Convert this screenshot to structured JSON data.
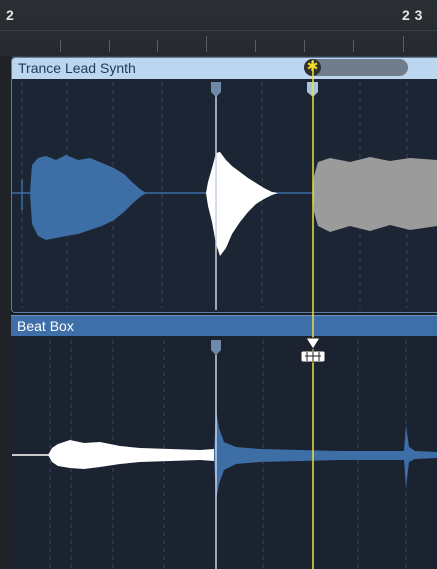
{
  "ruler": {
    "bar_left": "2",
    "bar_right": "2 3"
  },
  "tracks": [
    {
      "name": "Trance Lead Synth"
    },
    {
      "name": "Beat Box"
    }
  ],
  "icons": {
    "playhead": "playhead-icon",
    "flex_marker": "flex-marker-icon",
    "flex_tool_cursor": "flex-tool-cursor-icon",
    "progress_knob": "transient-tool-knob-icon"
  },
  "colors": {
    "lead_header": "#bcd6f0",
    "beatbox_header": "#3e6fa8",
    "waveform_blue": "#3d6fa6",
    "waveform_white": "#ffffff",
    "waveform_gray": "#9b9b9b",
    "playhead_yellow": "#e8e23a"
  }
}
